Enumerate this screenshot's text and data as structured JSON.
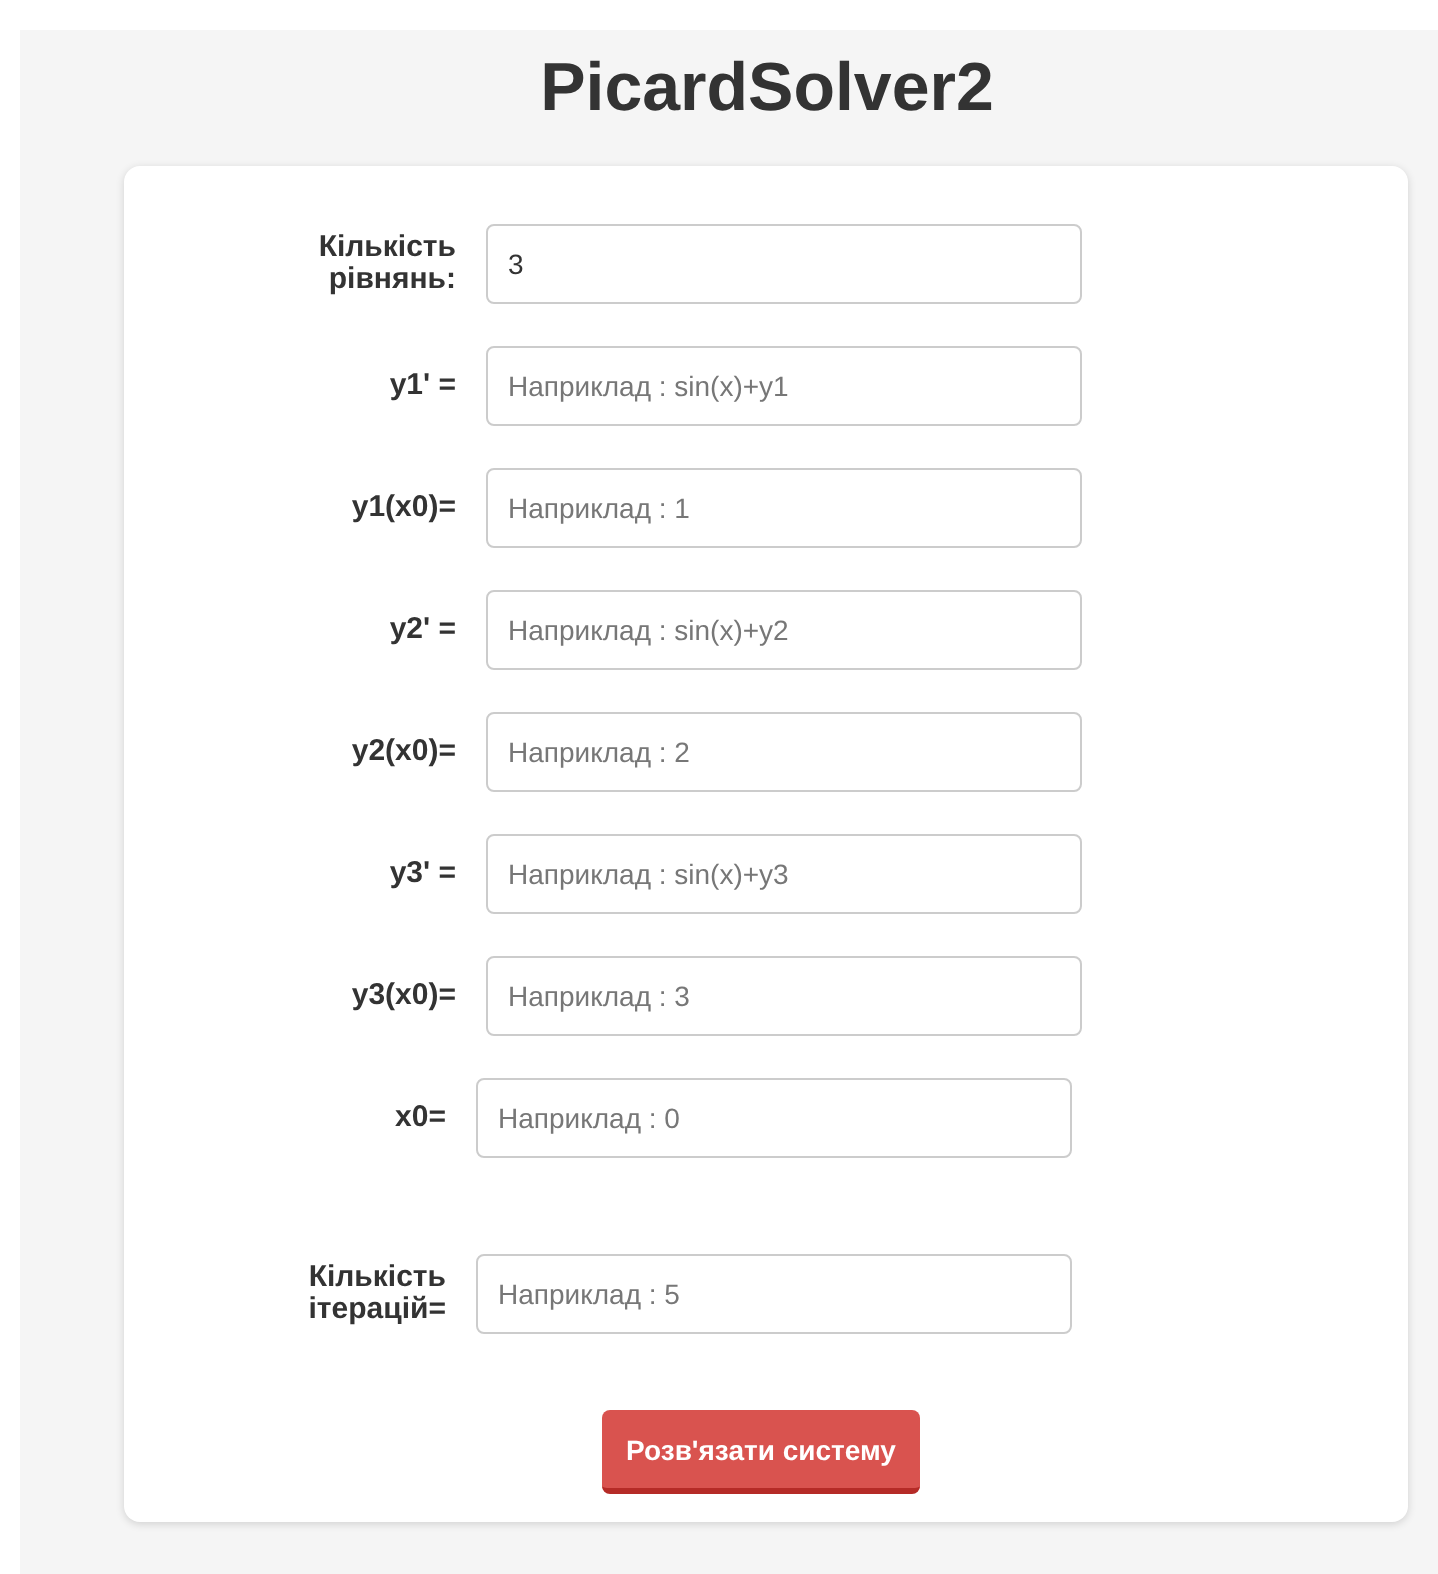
{
  "title": "PicardSolver2",
  "fields": [
    {
      "label": "Кількість рівнянь:",
      "value": "3"
    },
    {
      "label": "y1' =",
      "placeholder": "Наприклад : sin(x)+y1"
    },
    {
      "label": "y1(x0)=",
      "placeholder": "Наприклад : 1"
    },
    {
      "label": "y2' =",
      "placeholder": "Наприклад : sin(x)+y2"
    },
    {
      "label": "y2(x0)=",
      "placeholder": "Наприклад : 2"
    },
    {
      "label": "y3' =",
      "placeholder": "Наприклад : sin(x)+y3"
    },
    {
      "label": "y3(x0)=",
      "placeholder": "Наприклад : 3"
    },
    {
      "label": "x0=",
      "placeholder": "Наприклад : 0"
    }
  ],
  "iterations": {
    "label": "Кількість ітерацій=",
    "placeholder": "Наприклад : 5"
  },
  "submit_button": "Розв'язати систему"
}
